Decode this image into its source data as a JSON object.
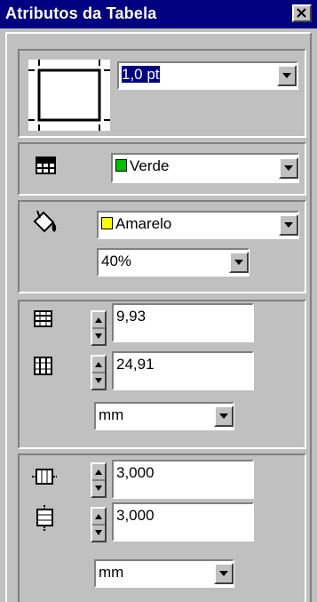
{
  "window": {
    "title": "Atributos da Tabela"
  },
  "border": {
    "weight": "1,0 pt"
  },
  "grid_color": {
    "label": "Verde",
    "swatch": "#00c000"
  },
  "fill": {
    "color_label": "Amarelo",
    "swatch": "#ffff00",
    "shade": "40%"
  },
  "cell_size": {
    "height": "9,93",
    "width": "24,91",
    "unit": "mm"
  },
  "cell_margin": {
    "horizontal": "3,000",
    "vertical": "3,000",
    "unit": "mm"
  },
  "icons": {
    "close": "close-icon",
    "border_preview": "border-preview-icon",
    "grid": "table-grid-icon",
    "fill": "paint-bucket-icon",
    "row_height": "row-height-icon",
    "column_width": "column-width-icon",
    "horizontal_margin": "horizontal-margin-icon",
    "vertical_margin": "vertical-margin-icon"
  }
}
